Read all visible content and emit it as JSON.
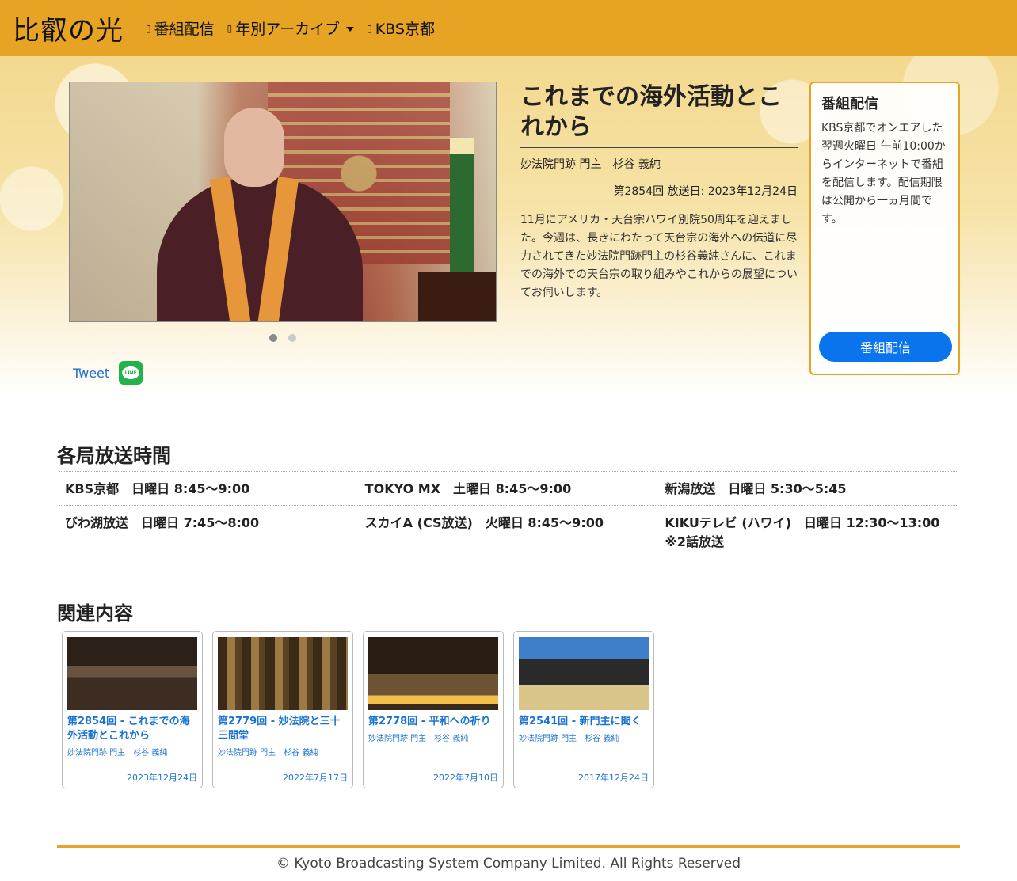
{
  "navbar": {
    "brand": "比叡の光",
    "items": [
      {
        "label": "番組配信",
        "icon": "broadcast-icon"
      },
      {
        "label": "年別アーカイブ",
        "icon": "archive-icon",
        "dropdown": true
      },
      {
        "label": "KBS京都",
        "icon": "link-icon"
      }
    ]
  },
  "hero": {
    "episode_title": "これまでの海外活動とこれから",
    "performer": "妙法院門跡 門主　杉谷 義純",
    "meta": "第2854回 放送日: 2023年12月24日",
    "description": "11月にアメリカ・天台宗ハワイ別院50周年を迎えました。今週は、長きにわたって天台宗の海外への伝道に尽力されてきた妙法院門跡門主の杉谷義純さんに、これまでの海外での天台宗の取り組みやこれからの展望についてお伺いします。",
    "carousel": {
      "count": 2,
      "active": 0
    }
  },
  "share": {
    "tweet_label": "Tweet",
    "line_label": "LINE"
  },
  "delivery": {
    "title": "番組配信",
    "text": "KBS京都でオンエアした翌週火曜日 午前10:00からインターネットで番組を配信します。配信期限は公開から一ヵ月間です。",
    "button": "番組配信"
  },
  "broadcast": {
    "title": "各局放送時間",
    "rows": [
      [
        "KBS京都　日曜日 8:45〜9:00",
        "TOKYO MX　土曜日 8:45〜9:00",
        "新潟放送　日曜日 5:30〜5:45"
      ],
      [
        "びわ湖放送　日曜日 7:45〜8:00",
        "スカイA (CS放送)　火曜日 8:45〜9:00",
        "KIKUテレビ (ハワイ)　日曜日 12:30〜13:00 ※2話放送"
      ]
    ]
  },
  "related": {
    "title": "関連内容",
    "cards": [
      {
        "title": "第2854回 - これまでの海外活動とこれから",
        "performer": "妙法院門跡 門主　杉谷 義純",
        "date": "2023年12月24日"
      },
      {
        "title": "第2779回 - 妙法院と三十三間堂",
        "performer": "妙法院門跡 門主　杉谷 義純",
        "date": "2022年7月17日"
      },
      {
        "title": "第2778回 - 平和への祈り",
        "performer": "妙法院門跡 門主　杉谷 義純",
        "date": "2022年7月10日"
      },
      {
        "title": "第2541回 - 新門主に聞く",
        "performer": "妙法院門跡 門主　杉谷 義純",
        "date": "2017年12月24日"
      }
    ]
  },
  "footer": {
    "copyright": "© Kyoto Broadcasting System Company Limited. All Rights Reserved"
  },
  "colors": {
    "navbar": "#e7a424",
    "accent_blue": "#0a74ee",
    "link_blue": "#1a73d1"
  }
}
